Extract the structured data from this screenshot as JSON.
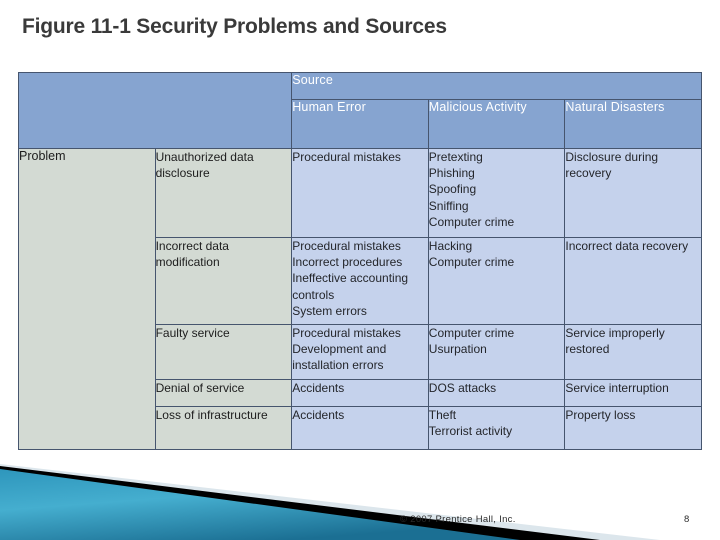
{
  "slide": {
    "title": "Figure 11-1 Security Problems and Sources",
    "footer": {
      "copyright": "© 2007 Prentice Hall, Inc.",
      "page_number": "8"
    }
  },
  "colors": {
    "header_blue": "#86A4D0",
    "cell_blue": "#C5D2EC",
    "problem_gray": "#D3DAD3",
    "border": "#46556E",
    "title_text": "#3A3A3A",
    "swoosh_teal_dark": "#1B6F93",
    "swoosh_teal_light": "#45AECF",
    "swoosh_black": "#000000",
    "swoosh_pale": "#DCE6EC"
  },
  "table": {
    "corner_label": "",
    "source_header": "Source",
    "row_axis_label": "Problem",
    "source_columns": [
      "Human Error",
      "Malicious Activity",
      "Natural Disasters"
    ],
    "rows": [
      {
        "problem": "Unauthorized data disclosure",
        "human_error": [
          "Procedural mistakes"
        ],
        "malicious_activity": [
          "Pretexting",
          "Phishing",
          "Spoofing",
          "Sniffing",
          "Computer crime"
        ],
        "natural_disasters": [
          "Disclosure during recovery"
        ]
      },
      {
        "problem": "Incorrect data modification",
        "human_error": [
          "Procedural mistakes",
          "Incorrect procedures",
          "Ineffective accounting controls",
          "System errors"
        ],
        "malicious_activity": [
          "Hacking",
          "Computer crime"
        ],
        "natural_disasters": [
          "Incorrect data recovery"
        ]
      },
      {
        "problem": "Faulty service",
        "human_error": [
          "Procedural mistakes",
          "Development and installation errors"
        ],
        "malicious_activity": [
          "Computer crime",
          "Usurpation"
        ],
        "natural_disasters": [
          "Service improperly restored"
        ]
      },
      {
        "problem": "Denial of service",
        "human_error": [
          "Accidents"
        ],
        "malicious_activity": [
          "DOS attacks"
        ],
        "natural_disasters": [
          "Service interruption"
        ]
      },
      {
        "problem": "Loss of infrastructure",
        "human_error": [
          "Accidents"
        ],
        "malicious_activity": [
          "Theft",
          "Terrorist activity"
        ],
        "natural_disasters": [
          "Property loss"
        ]
      }
    ]
  }
}
